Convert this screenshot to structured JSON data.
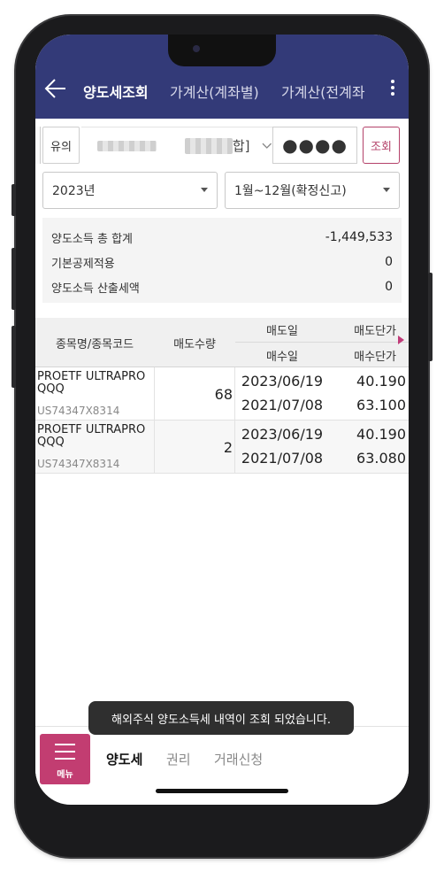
{
  "header": {
    "tabs": [
      {
        "label": "양도세조회",
        "active": true
      },
      {
        "label": "가계산(계좌별)",
        "active": false
      },
      {
        "label": "가계산(전계좌",
        "active": false
      }
    ]
  },
  "account": {
    "type_button": "유의",
    "account_suffix": "합]",
    "password_mask": "●●●●",
    "query_button": "조회"
  },
  "filters": {
    "year": "2023년",
    "period": "1월~12월(확정신고)"
  },
  "summary": {
    "rows": [
      {
        "label": "양도소득 총 합계",
        "value": "-1,449,533"
      },
      {
        "label": "기본공제적용",
        "value": "0"
      },
      {
        "label": "양도소득 산출세액",
        "value": "0"
      }
    ]
  },
  "table": {
    "headers": {
      "name": "종목명/종목코드",
      "qty": "매도수량",
      "sell_date": "매도일",
      "buy_date": "매수일",
      "sell_price": "매도단가",
      "buy_price": "매수단가"
    },
    "rows": [
      {
        "name": "PROETF ULTRAPRO QQQ",
        "code": "US74347X8314",
        "qty": "68",
        "sell_date": "2023/06/19",
        "buy_date": "2021/07/08",
        "sell_price": "40.190",
        "buy_price": "63.100"
      },
      {
        "name": "PROETF ULTRAPRO QQQ",
        "code": "US74347X8314",
        "qty": "2",
        "sell_date": "2023/06/19",
        "buy_date": "2021/07/08",
        "sell_price": "40.190",
        "buy_price": "63.080"
      }
    ]
  },
  "toast": "해외주식 양도소득세 내역이 조회 되었습니다.",
  "bottom_nav": {
    "menu_label": "메뉴",
    "tabs": [
      {
        "label": "양도세",
        "active": true
      },
      {
        "label": "권리",
        "active": false
      },
      {
        "label": "거래신청",
        "active": false
      }
    ]
  },
  "colors": {
    "header_bg": "#333a78",
    "accent": "#c23d71"
  }
}
